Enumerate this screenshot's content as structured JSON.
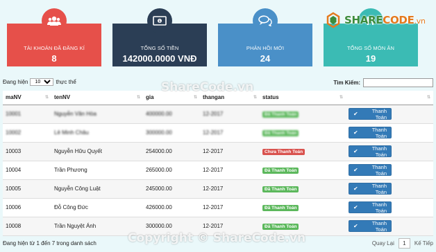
{
  "cards": [
    {
      "label": "Tài khoản đã đăng kí",
      "value": "8",
      "icon": "users-icon",
      "color": "#e6504a"
    },
    {
      "label": "Tổng số tiền",
      "value": "142000.0000 VNĐ",
      "icon": "money-icon",
      "color": "#2b3e55"
    },
    {
      "label": "Phản hồi mới",
      "value": "24",
      "icon": "comments-icon",
      "color": "#4a90c8"
    },
    {
      "label": "Tổng số món ăn",
      "value": "19",
      "icon": "food-icon",
      "color": "#3bbbb4"
    }
  ],
  "logo": {
    "part1": "SHARE",
    "part2": "CODE",
    "part3": ".vn"
  },
  "controls": {
    "show_prefix": "Đang hiện",
    "entries_selected": "10",
    "show_suffix": "thực thể",
    "search_label": "Tìm Kiếm:",
    "search_value": ""
  },
  "table": {
    "headers": [
      "maNV",
      "tenNV",
      "gia",
      "thangan",
      "status",
      ""
    ],
    "rows": [
      {
        "maNV": "10001",
        "tenNV": "Nguyễn Văn Hòa",
        "gia": "400000.00",
        "thangan": "12-2017",
        "status": "Đã Thanh Toán",
        "paid": true,
        "action": "Thanh Toán"
      },
      {
        "maNV": "10002",
        "tenNV": "Lê Minh Châu",
        "gia": "300000.00",
        "thangan": "12-2017",
        "status": "Đã Thanh Toán",
        "paid": true,
        "action": "Thanh Toán"
      },
      {
        "maNV": "10003",
        "tenNV": "Nguyễn Hữu Quyết",
        "gia": "254000.00",
        "thangan": "12-2017",
        "status": "Chưa Thanh Toán",
        "paid": false,
        "action": "Thanh Toán"
      },
      {
        "maNV": "10004",
        "tenNV": "Trần Phương",
        "gia": "265000.00",
        "thangan": "12-2017",
        "status": "Đã Thanh Toán",
        "paid": true,
        "action": "Thanh Toán"
      },
      {
        "maNV": "10005",
        "tenNV": "Nguyễn Công Luật",
        "gia": "245000.00",
        "thangan": "12-2017",
        "status": "Đã Thanh Toán",
        "paid": true,
        "action": "Thanh Toán"
      },
      {
        "maNV": "10006",
        "tenNV": "Đỗ Công Đức",
        "gia": "426000.00",
        "thangan": "12-2017",
        "status": "Đã Thanh Toán",
        "paid": true,
        "action": "Thanh Toán"
      },
      {
        "maNV": "10008",
        "tenNV": "Trần Nguyệt Ánh",
        "gia": "300000.00",
        "thangan": "12-2017",
        "status": "Đã Thanh Toán",
        "paid": true,
        "action": "Thanh Toán"
      }
    ]
  },
  "footer": {
    "info": "Đang hiện từ 1 đến 7 trong danh sách",
    "prev": "Quay Lại",
    "current_page": "1",
    "next": "Kế Tiếp"
  },
  "watermarks": [
    "ShareCode.vn",
    "Copyright © ShareCode.vn"
  ],
  "colors": {
    "button": "#337ab7",
    "paid": "#5cb85c",
    "unpaid": "#d9534f",
    "background": "#eaf8fa"
  }
}
